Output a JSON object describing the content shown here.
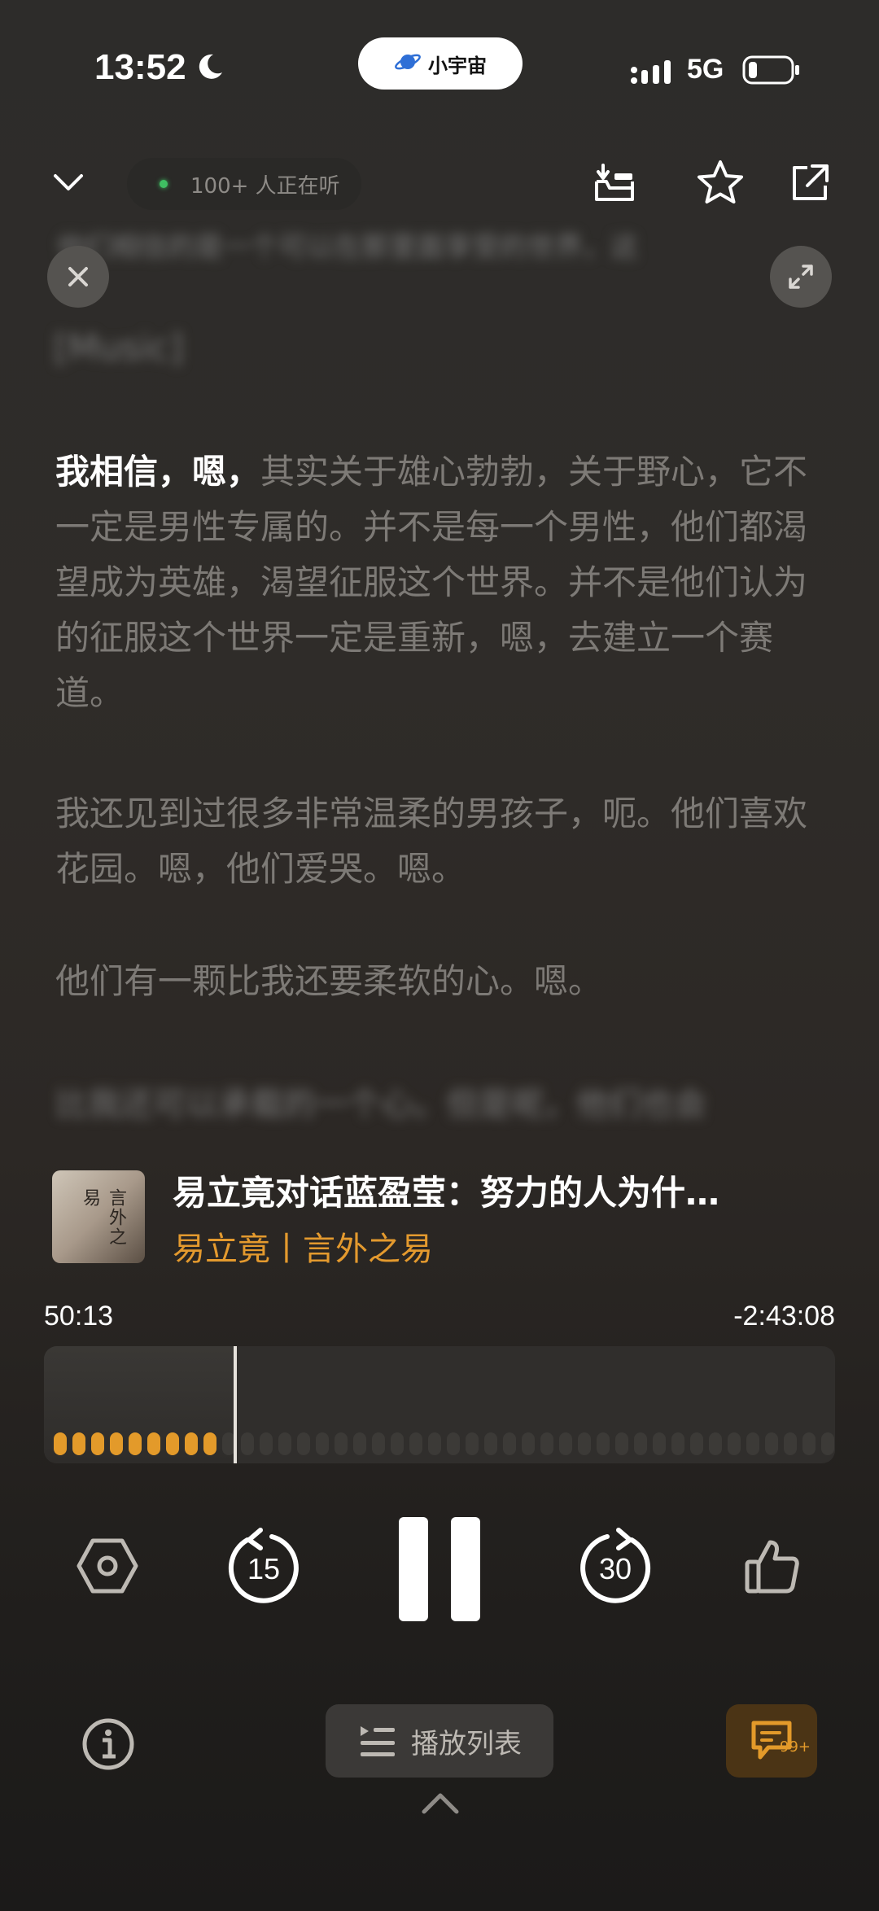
{
  "status_bar": {
    "time": "13:52",
    "app_pill": "小宇宙",
    "network": "5G"
  },
  "top_bar": {
    "listeners": "100+ 人正在听"
  },
  "transcript": {
    "blurred_top_line": "他们相信的是一个可以在那里面享受的世界，这",
    "music_tag": "[Music]",
    "current_highlight": "我相信，嗯，",
    "current_rest": "其实关于雄心勃勃，关于野心，它不一定是男性专属的。并不是每一个男性，他们都渴望成为英雄，渴望征服这个世界。并不是他们认为的征服这个世界一定是重新，嗯，去建立一个赛道。",
    "para2": "我还见到过很多非常温柔的男孩子，呃。他们喜欢花园。嗯，他们爱哭。嗯。",
    "para3": "他们有一颗比我还要柔软的心。嗯。",
    "blurred_bottom_line": "比我还可以承载的一个心。但是呢，他们也会"
  },
  "episode": {
    "cover_text": "言外之易",
    "title": "易立竟对话蓝盈莹：努力的人为什…",
    "author_show": "易立竟丨言外之易"
  },
  "progress": {
    "elapsed": "50:13",
    "remaining": "-2:43:08",
    "fraction": 0.24
  },
  "controls": {
    "rewind_seconds": "15",
    "forward_seconds": "30"
  },
  "bottom": {
    "playlist_label": "播放列表",
    "comments_count": "99+"
  }
}
